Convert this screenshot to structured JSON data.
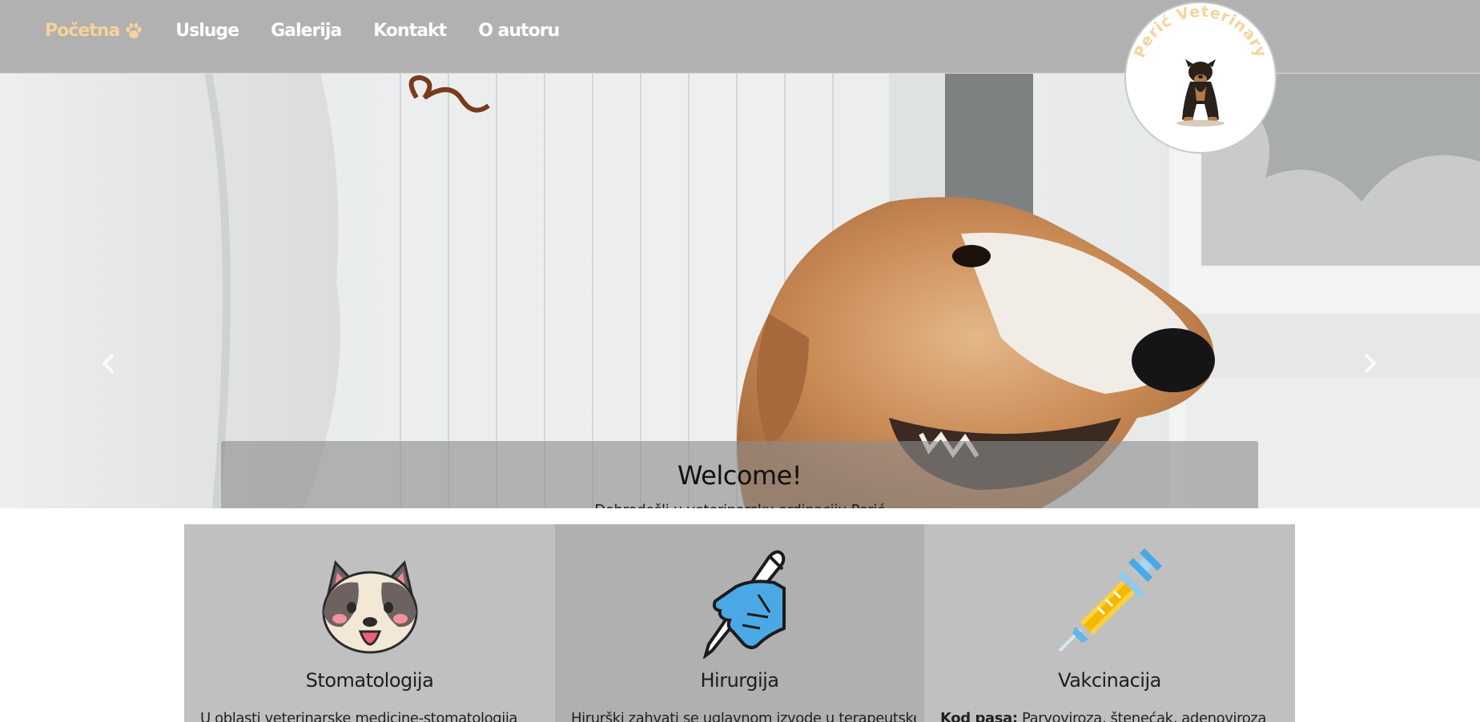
{
  "nav": {
    "items": [
      {
        "label": "Početna",
        "active": true
      },
      {
        "label": "Usluge",
        "active": false
      },
      {
        "label": "Galerija",
        "active": false
      },
      {
        "label": "Kontakt",
        "active": false
      },
      {
        "label": "O autoru",
        "active": false
      }
    ],
    "active_color": "#f6d39a",
    "logo_text": "Perić Veterinary"
  },
  "carousel": {
    "caption_title": "Welcome!",
    "caption_text": "Dobrodošli u veterinarsku ordinaciju Perić",
    "slide_count": 3,
    "active_slide": 1
  },
  "services": [
    {
      "title": "Stomatologija",
      "icon": "dog-face-icon",
      "text_bold": "",
      "text": "U oblasti veterinarske medicine-stomatologija"
    },
    {
      "title": "Hirurgija",
      "icon": "scalpel-hand-icon",
      "text_bold": "",
      "text": "Hirurški zahvati se uglavnom izvode u terapeutske"
    },
    {
      "title": "Vakcinacija",
      "icon": "syringe-icon",
      "text_bold": "Kod pasa:",
      "text": " Parvoviroza, štenećak, adenoviroza"
    }
  ]
}
